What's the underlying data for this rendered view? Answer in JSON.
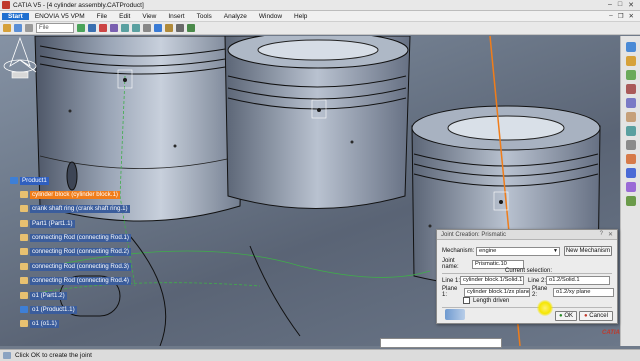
{
  "window": {
    "title": "CATIA V5 - [4 cylinder assembly.CATProduct]"
  },
  "menu": {
    "items": [
      "Start",
      "ENOVIA V5 VPM",
      "File",
      "Edit",
      "View",
      "Insert",
      "Tools",
      "Analyze",
      "Window",
      "Help"
    ]
  },
  "toolbar": {
    "filter_value": "File"
  },
  "tree": {
    "root": "Product1",
    "items": [
      {
        "label": "cylinder block (cylinder block.1)",
        "highlight": "orange"
      },
      {
        "label": "crank shaft ring (crank shaft ring.1)",
        "highlight": "none"
      },
      {
        "label": "Part1 (Part1.1)",
        "highlight": "none"
      },
      {
        "label": "connecting Rod (connecting Rod.1)",
        "highlight": "none"
      },
      {
        "label": "connecting Rod (connecting Rod.2)",
        "highlight": "none"
      },
      {
        "label": "connecting Rod (connecting Rod.3)",
        "highlight": "none"
      },
      {
        "label": "connecting Rod (connecting Rod.4)",
        "highlight": "none"
      },
      {
        "label": "o1 (Part1.2)",
        "highlight": "none"
      },
      {
        "label": "o1 (Product1.1)",
        "highlight": "none"
      },
      {
        "label": "o1 (o1.1)",
        "highlight": "none"
      }
    ]
  },
  "dialog": {
    "title": "Joint Creation: Prismatic",
    "mechanism_label": "Mechanism:",
    "mechanism_value": "engine",
    "new_mechanism_label": "New Mechanism",
    "joint_name_label": "Joint name:",
    "joint_name_value": "Prismatic.10",
    "current_selection_label": "Current selection:",
    "line1_label": "Line 1:",
    "line1_value": "cylinder block.1/Solid.1",
    "line2_label": "Line 2:",
    "line2_value": "o1.2/Solid.1",
    "plane1_label": "Plane 1:",
    "plane1_value": "cylinder block.1/zx plane",
    "plane2_label": "Plane 2:",
    "plane2_value": "o1.2/xy plane",
    "length_driven_label": "Length driven",
    "length_driven_checked": false,
    "ok_label": "OK",
    "cancel_label": "Cancel"
  },
  "status": {
    "text": "Click OK to create the joint"
  },
  "logo": {
    "text": "CATIA"
  },
  "colors": {
    "accent_orange": "#f07d1a",
    "tree_blue": "#3b5d9c",
    "selection_yellow": "#f5e600"
  }
}
